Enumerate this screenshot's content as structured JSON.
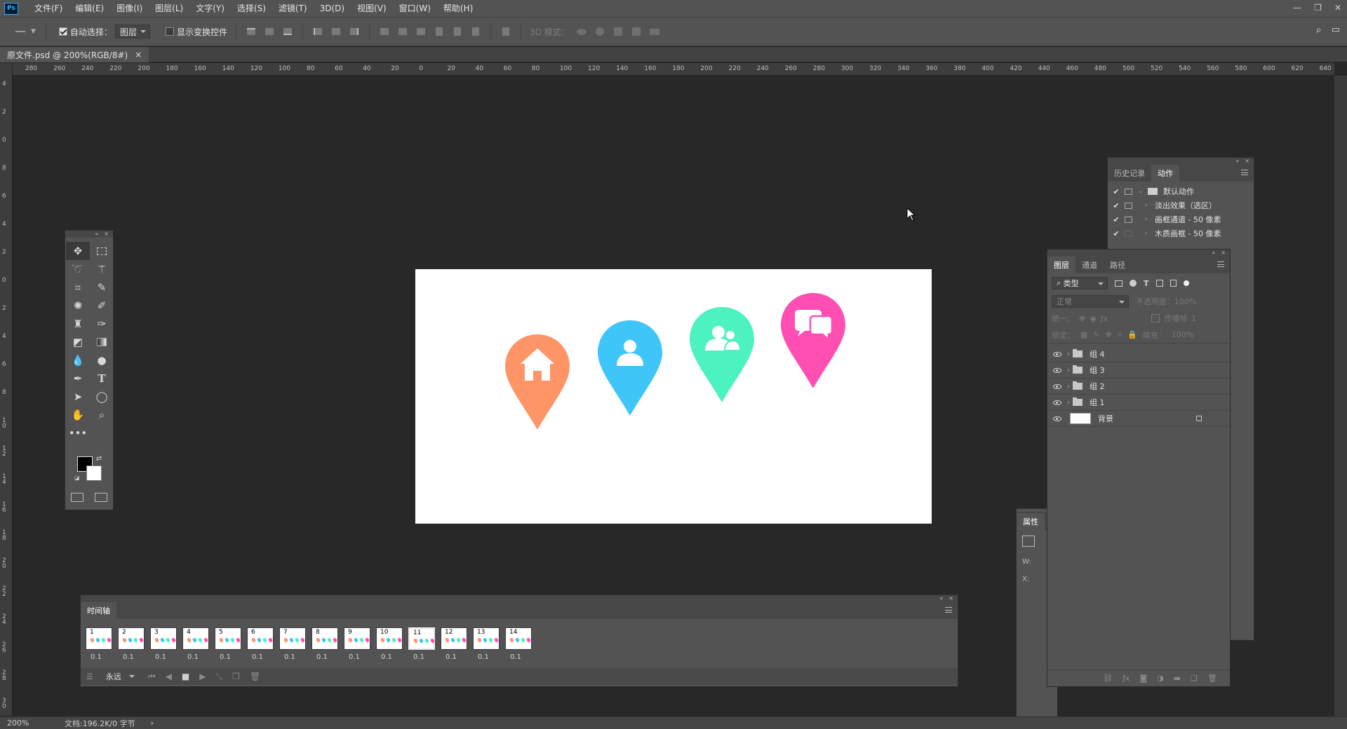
{
  "menubar": {
    "logo": "Ps",
    "items": [
      "文件(F)",
      "编辑(E)",
      "图像(I)",
      "图层(L)",
      "文字(Y)",
      "选择(S)",
      "滤镜(T)",
      "3D(D)",
      "视图(V)",
      "窗口(W)",
      "帮助(H)"
    ]
  },
  "options": {
    "auto_select_label": "自动选择：",
    "auto_select_checked": true,
    "auto_select_target": "图层",
    "show_transform_label": "显示变换控件",
    "mode3d_label": "3D 模式："
  },
  "document": {
    "tab_title": "原文件.psd @ 200%(RGB/8#)",
    "close_glyph": "×"
  },
  "ruler": {
    "top_labels": [
      "280",
      "260",
      "240",
      "220",
      "200",
      "180",
      "160",
      "140",
      "120",
      "100",
      "80",
      "60",
      "40",
      "20",
      "0",
      "20",
      "40",
      "60",
      "80",
      "100",
      "120",
      "140",
      "160",
      "180",
      "200",
      "220",
      "240",
      "260",
      "280",
      "300",
      "320",
      "340",
      "360",
      "380",
      "400",
      "420",
      "440",
      "460",
      "480",
      "500",
      "520",
      "540",
      "560",
      "580",
      "600",
      "620",
      "640"
    ],
    "left_labels": [
      "4",
      "2",
      "0",
      "8",
      "6",
      "4",
      "2",
      "0",
      "2",
      "4",
      "6",
      "8",
      "1 0",
      "1 2",
      "1 4",
      "1 6",
      "1 8",
      "2 0",
      "2 2",
      "2 4",
      "2 6",
      "2 8",
      "3 0"
    ]
  },
  "canvas": {
    "background": "#ffffff",
    "pins": [
      {
        "name": "home",
        "color": "#ff9466"
      },
      {
        "name": "user",
        "color": "#3ec6f9"
      },
      {
        "name": "users",
        "color": "#4cf2c0"
      },
      {
        "name": "chat",
        "color": "#ff4fb2"
      }
    ]
  },
  "actions_panel": {
    "tabs": [
      "历史记录",
      "动作"
    ],
    "active_tab": "动作",
    "rows": [
      {
        "label": "默认动作",
        "type": "folder"
      },
      {
        "label": "淡出效果（选区）",
        "type": "action"
      },
      {
        "label": "画框通道 - 50 像素",
        "type": "action"
      },
      {
        "label": "木质画框 - 50 像素",
        "type": "action"
      }
    ]
  },
  "layers_panel": {
    "tabs": [
      "图层",
      "通道",
      "路径"
    ],
    "active_tab": "图层",
    "filter_label": "类型",
    "blend_mode": "正常",
    "opacity_label": "不透明度：",
    "opacity_value": "100%",
    "unify_label": "统一：",
    "propagate_label": "传播帧",
    "propagate_value": "1",
    "lock_label": "锁定：",
    "fill_label": "填充：",
    "fill_value": "100%",
    "layers": [
      {
        "name": "组 4",
        "kind": "group"
      },
      {
        "name": "组 3",
        "kind": "group"
      },
      {
        "name": "组 2",
        "kind": "group"
      },
      {
        "name": "组 1",
        "kind": "group"
      },
      {
        "name": "背景",
        "kind": "background"
      }
    ]
  },
  "properties_panel": {
    "title": "属性",
    "w_label": "W:",
    "x_label": "X:"
  },
  "timeline": {
    "title": "时间轴",
    "frames": [
      {
        "num": "1",
        "dur": "0.1"
      },
      {
        "num": "2",
        "dur": "0.1"
      },
      {
        "num": "3",
        "dur": "0.1"
      },
      {
        "num": "4",
        "dur": "0.1"
      },
      {
        "num": "5",
        "dur": "0.1"
      },
      {
        "num": "6",
        "dur": "0.1"
      },
      {
        "num": "7",
        "dur": "0.1"
      },
      {
        "num": "8",
        "dur": "0.1"
      },
      {
        "num": "9",
        "dur": "0.1"
      },
      {
        "num": "10",
        "dur": "0.1"
      },
      {
        "num": "11",
        "dur": "0.1"
      },
      {
        "num": "12",
        "dur": "0.1"
      },
      {
        "num": "13",
        "dur": "0.1"
      },
      {
        "num": "14",
        "dur": "0.1"
      }
    ],
    "selected_frame": "11",
    "loop_label": "永远"
  },
  "status": {
    "zoom": "200%",
    "doc_info": "文档:196.2K/0 字节",
    "arrow": "›"
  },
  "colors": {
    "foreground": "#000000",
    "background": "#ffffff"
  }
}
